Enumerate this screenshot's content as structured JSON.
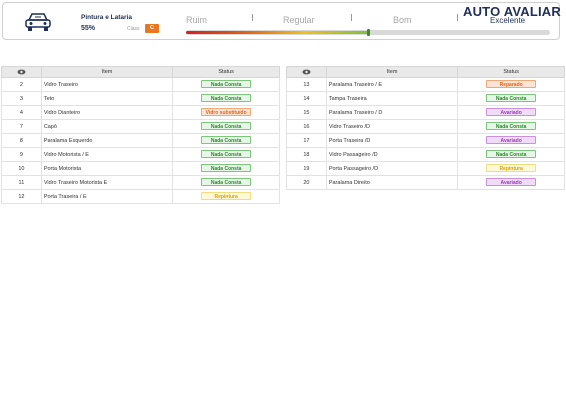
{
  "header": {
    "category": "Pintura e Lataria",
    "percent": "55%",
    "class_label": "Class",
    "class_value": "C",
    "scale": [
      "Ruim",
      "Regular",
      "Bom",
      "Excelente"
    ],
    "scale_level": 0.5,
    "brand": "AUTO AVALIAR"
  },
  "colors": {
    "brand": "#1f2f57",
    "class_badge": "#e8771f"
  },
  "table_headers": {
    "icon": "eye-icon",
    "item": "Item",
    "status": "Status"
  },
  "left_rows": [
    {
      "num": "2",
      "item": "Vidro Traseiro",
      "status": "Nada Consta",
      "kind": "green"
    },
    {
      "num": "3",
      "item": "Teto",
      "status": "Nada Consta",
      "kind": "green"
    },
    {
      "num": "4",
      "item": "Vidro Dianteiro",
      "status": "Vidro substituído",
      "kind": "orange"
    },
    {
      "num": "7",
      "item": "Capô",
      "status": "Nada Consta",
      "kind": "green"
    },
    {
      "num": "8",
      "item": "Paralama Esquerdo",
      "status": "Nada Consta",
      "kind": "green"
    },
    {
      "num": "9",
      "item": "Vidro Motorista / E",
      "status": "Nada Consta",
      "kind": "green"
    },
    {
      "num": "10",
      "item": "Porta Motorista",
      "status": "Nada Consta",
      "kind": "green"
    },
    {
      "num": "11",
      "item": "Vidro Traseiro Motorista E",
      "status": "Nada Consta",
      "kind": "green"
    },
    {
      "num": "12",
      "item": "Porta Traseira / E",
      "status": "Repintura",
      "kind": "yellow"
    }
  ],
  "right_rows": [
    {
      "num": "13",
      "item": "Paralama Traseiro / E",
      "status": "Reparado",
      "kind": "orange"
    },
    {
      "num": "14",
      "item": "Tampa Traseira",
      "status": "Nada Consta",
      "kind": "green"
    },
    {
      "num": "15",
      "item": "Paralama Traseiro / D",
      "status": "Avariado",
      "kind": "purple"
    },
    {
      "num": "16",
      "item": "Vidro Traseiro /D",
      "status": "Nada Consta",
      "kind": "green"
    },
    {
      "num": "17",
      "item": "Porta Traseira /D",
      "status": "Avariado",
      "kind": "purple"
    },
    {
      "num": "18",
      "item": "Vidro Passageiro /D",
      "status": "Nada Consta",
      "kind": "green"
    },
    {
      "num": "19",
      "item": "Porta Passageiro /D",
      "status": "Repintura",
      "kind": "yellow"
    },
    {
      "num": "20",
      "item": "Paralama Direito",
      "status": "Avariado",
      "kind": "purple"
    }
  ]
}
